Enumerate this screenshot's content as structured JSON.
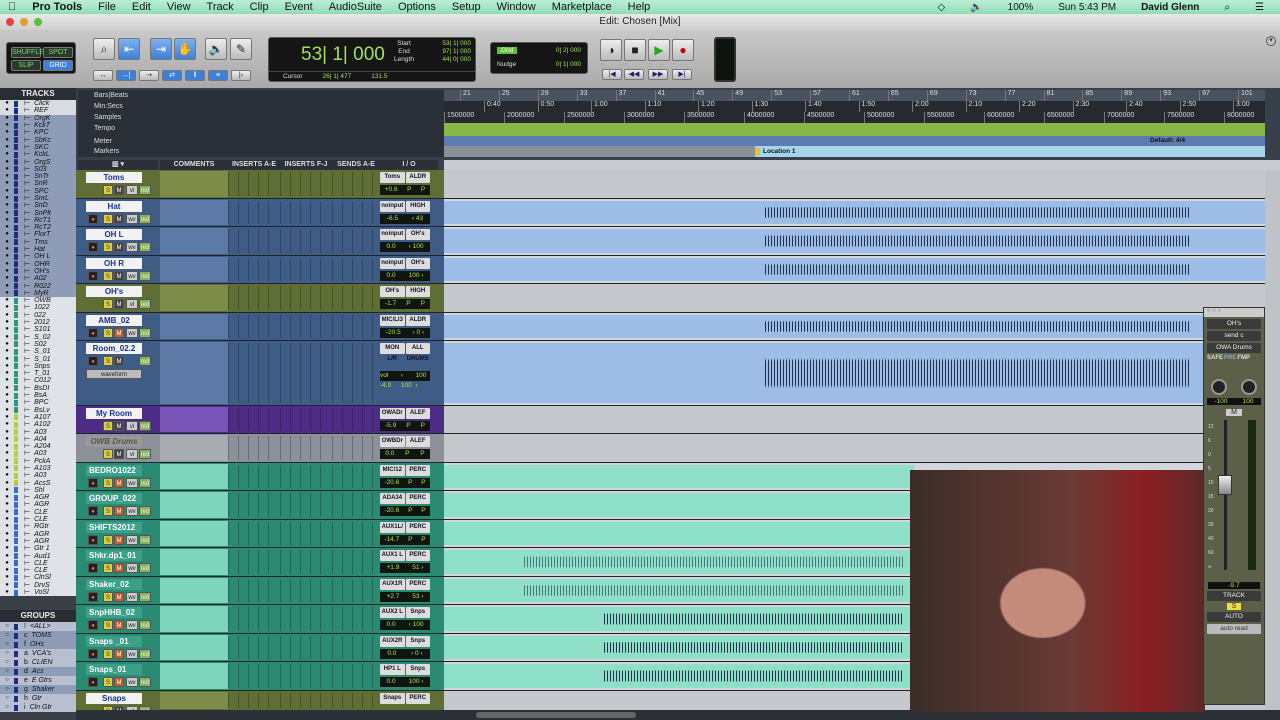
{
  "menubar": {
    "apple": "",
    "app": "Pro Tools",
    "items": [
      "File",
      "Edit",
      "View",
      "Track",
      "Clip",
      "Event",
      "AudioSuite",
      "Options",
      "Setup",
      "Window",
      "Marketplace",
      "Help"
    ],
    "battery": "100%",
    "clock": "Sun 5:43 PM",
    "user": "David Glenn"
  },
  "window": {
    "title": "Edit: Chosen [Mix]"
  },
  "toolbar": {
    "modes": [
      "SHUFFLE",
      "SPOT",
      "SLIP",
      "GRID"
    ],
    "active_mode": "GRID",
    "main_counter": "53| 1| 000",
    "start_label": "Start",
    "end_label": "End",
    "length_label": "Length",
    "start": "53| 1| 000",
    "end": "97| 1| 000",
    "length": "44| 0| 000",
    "cursor_label": "Cursor",
    "cursor": "26| 1| 477",
    "tempo": "131.5",
    "grid_label": "Grid",
    "grid_value": "0| 2| 000",
    "nudge_label": "Nudge",
    "nudge_value": "0| 1| 000"
  },
  "sidebar": {
    "tracks_title": "TRACKS",
    "tracks": [
      "Click",
      "REF",
      "OrgK",
      "KckT",
      "KPC",
      "SbKc",
      "SKC",
      "KckL",
      "OrgS",
      "S03",
      "SnTr",
      "SnR",
      "SPC",
      "SnrL",
      "SnD",
      "SnPlt",
      "RcT1",
      "RcT2",
      "FlorT",
      "Tms",
      "Hat",
      "OH L",
      "OHR",
      "OH's",
      "A02",
      "R022",
      "MyR",
      "OWB",
      "1022",
      "022",
      "2012",
      "S101",
      "S_02",
      "S02",
      "S_01",
      "S_01",
      "Snps",
      "T_01",
      "C012",
      "BsDI",
      "BsA",
      "BPC",
      "BsLv",
      "A107",
      "A102",
      "A03",
      "A04",
      "A204",
      "A03",
      "PckA",
      "A103",
      "A03",
      "AcsS",
      "Shl",
      "AGR",
      "AGR",
      "CLE",
      "CLE",
      "RGtr",
      "AGR",
      "AGR",
      "Gtr 1",
      "Aud1",
      "CLE",
      "CLE",
      "ClnSl",
      "DrvS",
      "VoSl"
    ],
    "groups_title": "GROUPS",
    "groups": [
      {
        "id": "!",
        "name": "<ALL>"
      },
      {
        "id": "c",
        "name": "TOMS"
      },
      {
        "id": "f",
        "name": "OHs"
      },
      {
        "id": "a",
        "name": "VCA's"
      },
      {
        "id": "b",
        "name": "CLIEN"
      },
      {
        "id": "d",
        "name": "Acs"
      },
      {
        "id": "e",
        "name": "E Gtrs"
      },
      {
        "id": "g",
        "name": "Shaker"
      },
      {
        "id": "h",
        "name": "Gtr"
      },
      {
        "id": "i",
        "name": "Cln Gtr"
      }
    ]
  },
  "rulers": {
    "labels": [
      "Bars|Beats",
      "Min:Secs",
      "Samples",
      "Tempo",
      "Meter",
      "Markers"
    ],
    "bars": [
      "21",
      "25",
      "29",
      "33",
      "37",
      "41",
      "45",
      "49",
      "53",
      "57",
      "61",
      "65",
      "69",
      "73",
      "77",
      "81",
      "85",
      "89",
      "93",
      "97",
      "101"
    ],
    "minsecs": [
      "0:40",
      "0:50",
      "1:00",
      "1:10",
      "1:20",
      "1:30",
      "1:40",
      "1:50",
      "2:00",
      "2:10",
      "2:20",
      "2:30",
      "2:40",
      "2:50",
      "3:00"
    ],
    "samples": [
      "1500000",
      "2000000",
      "2500000",
      "3000000",
      "3500000",
      "4000000",
      "4500000",
      "5000000",
      "5500000",
      "6000000",
      "6500000",
      "7000000",
      "7500000",
      "8000000"
    ],
    "meter": "Default: 4/4",
    "marker": "Location 1"
  },
  "columns": {
    "comments": "COMMENTS",
    "inserts_ae": "INSERTS A-E",
    "inserts_fj": "INSERTS F-J",
    "sends_ae": "SENDS A-E",
    "io": "I / O"
  },
  "tracks": [
    {
      "name": "Toms",
      "kind": "aux",
      "input": "Toms",
      "output": "ALDR",
      "vol": "+0.6",
      "pan": "P",
      "pan2": "P",
      "view": "vl",
      "h": 29
    },
    {
      "name": "Hat",
      "kind": "audio",
      "input": "noinput",
      "output": "HIGH",
      "vol": "-6.5",
      "pan": "‹ 43",
      "pan2": "",
      "view": "wv",
      "h": 28
    },
    {
      "name": "OH L",
      "kind": "audio",
      "input": "noinput",
      "output": "OH's",
      "vol": "0.0",
      "pan": "‹ 100",
      "pan2": "",
      "view": "wv",
      "h": 29
    },
    {
      "name": "OH R",
      "kind": "audio",
      "input": "noinput",
      "output": "OH's",
      "vol": "0.0",
      "pan": "100 ›",
      "pan2": "",
      "view": "wv",
      "h": 28
    },
    {
      "name": "OH's",
      "kind": "aux",
      "input": "OH's",
      "output": "HIGH",
      "vol": "-1.7",
      "pan": "P",
      "pan2": "P",
      "view": "vl",
      "h": 29
    },
    {
      "name": "AMB_02",
      "kind": "audio",
      "input": "MIC/LI3",
      "output": "ALDR",
      "vol": "-20.5",
      "pan": "› 0 ‹",
      "pan2": "",
      "view": "wv",
      "h": 28
    },
    {
      "name": "Room_02.2",
      "kind": "room",
      "input": "MON L/R",
      "output": "ALL DRUMS",
      "vol": "vol -4.0",
      "pan": "‹ 100",
      "pan2": "100 ›",
      "view": "waveform",
      "h": 65
    },
    {
      "name": "My Room",
      "kind": "purple",
      "input": "OWADr",
      "output": "ALEF",
      "vol": "-5.9",
      "pan": "P",
      "pan2": "P",
      "view": "vl",
      "h": 28
    },
    {
      "name": "OWB Drums",
      "kind": "inactive",
      "input": "OWBDr",
      "output": "ALEF",
      "vol": "0.0",
      "pan": "P",
      "pan2": "P",
      "view": "vl",
      "h": 29
    },
    {
      "name": "BEDRO1022",
      "kind": "green",
      "input": "MIC/12",
      "output": "PERC",
      "vol": "-20.6",
      "pan": "P",
      "pan2": "P",
      "view": "wv",
      "h": 28
    },
    {
      "name": "GROUP_022",
      "kind": "green",
      "input": "ADA34",
      "output": "PERC",
      "vol": "-20.6",
      "pan": "P",
      "pan2": "P",
      "view": "wv",
      "h": 29
    },
    {
      "name": "SHIFTS2012",
      "kind": "green",
      "input": "AUX1L/",
      "output": "PERC",
      "vol": "-14.7",
      "pan": "P",
      "pan2": "P",
      "view": "wv",
      "h": 28
    },
    {
      "name": "Shkr.dp1_01",
      "kind": "green",
      "input": "AUX1 L",
      "output": "PERC",
      "vol": "+1.9",
      "pan": "51 ›",
      "pan2": "",
      "view": "wv",
      "h": 29
    },
    {
      "name": "Shaker_02",
      "kind": "green",
      "input": "AUX1R",
      "output": "PERC",
      "vol": "+2.7",
      "pan": "53 ›",
      "pan2": "",
      "view": "wv",
      "h": 28
    },
    {
      "name": "SnpHHB_02",
      "kind": "green",
      "input": "AUX2 L",
      "output": "Snps",
      "vol": "0.0",
      "pan": "‹ 100",
      "pan2": "",
      "view": "wv",
      "h": 29
    },
    {
      "name": "Snaps _01",
      "kind": "green",
      "input": "AUX2R",
      "output": "Snps",
      "vol": "0.0",
      "pan": "› 0 ‹",
      "pan2": "",
      "view": "wv",
      "h": 28
    },
    {
      "name": "Snaps_01",
      "kind": "green",
      "input": "HP1 L",
      "output": "Snps",
      "vol": "0.0",
      "pan": "100 ›",
      "pan2": "",
      "view": "wv",
      "h": 29
    },
    {
      "name": "Snaps",
      "kind": "aux",
      "input": "Snaps",
      "output": "PERC",
      "vol": "",
      "pan": "",
      "pan2": "",
      "view": "vl",
      "h": 20
    }
  ],
  "output_window": {
    "output": "OH's",
    "send": "send c",
    "path": "OWA Drums",
    "safe": "SAFE",
    "pre": "PRE",
    "fmp": "FMP",
    "pan_l": "-100",
    "pan_r": "100",
    "mute": "M",
    "fader_value": "-9.7",
    "track_label": "TRACK",
    "solo": "S",
    "auto_label": "AUTO",
    "auto_mode": "auto read",
    "scale": [
      "12",
      "6",
      "0",
      "5",
      "10",
      "15",
      "20",
      "30",
      "40",
      "60",
      "∞"
    ]
  },
  "colors": {
    "audio_track": "#3f5c86",
    "aux_track": "#6b7a3a",
    "green_track": "#2a8a72",
    "purple_track": "#6a3fa0",
    "clip_blue": "#9dbde6",
    "clip_green": "#8fe0c8",
    "tempo_ruler": "#8ab848",
    "meter_ruler": "#5c7bb0",
    "marker": "#a6d4ea",
    "counter": "#a8e44c"
  }
}
